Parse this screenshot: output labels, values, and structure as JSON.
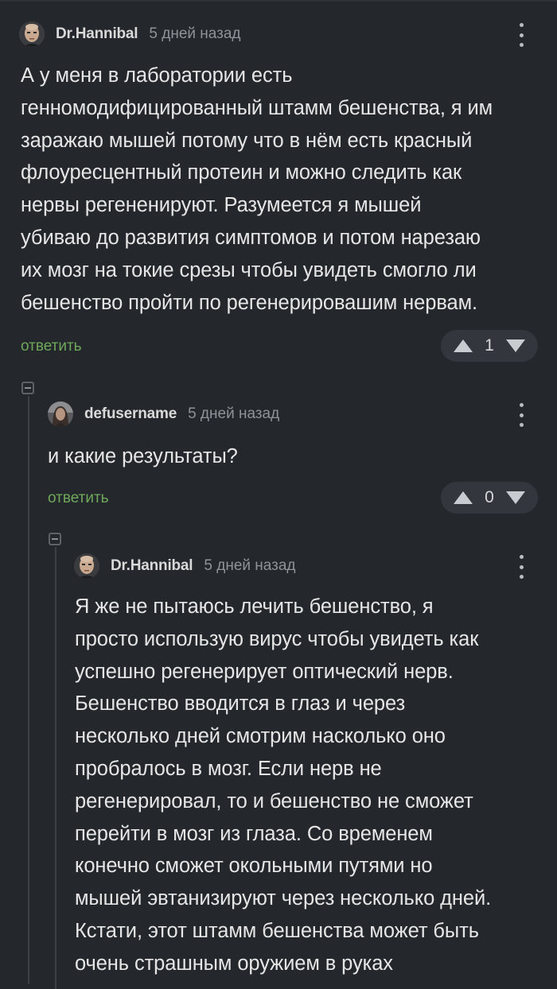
{
  "comments": [
    {
      "author": "Dr.Hannibal",
      "time": "5 дней назад",
      "avatar_icon": "bald-man-avatar-icon",
      "lines": [
        "А у меня в лаборатории есть",
        "генномодифицированный штамм бешенства, я им",
        "заражаю мышей потому что в нём есть красный",
        "флоуресцентный протеин и можно следить как",
        "нервы регененируют. Разумеется я мышей",
        "убиваю до развития симптомов и потом нарезаю",
        "их мозг на токие срезы чтобы увидеть смогло ли",
        "бешенство пройти по регенерировашим нервам."
      ],
      "reply_label": "ответить",
      "score": "1"
    },
    {
      "author": "defusername",
      "time": "5 дней назад",
      "avatar_icon": "long-hair-avatar-icon",
      "lines": [
        "и какие результаты?"
      ],
      "reply_label": "ответить",
      "score": "0"
    },
    {
      "author": "Dr.Hannibal",
      "time": "5 дней назад",
      "avatar_icon": "bald-man-avatar-icon",
      "lines": [
        "Я же не пытаюсь лечить бешенство, я",
        "просто использую вирус чтобы увидеть как",
        "успешно регенерирует оптический нерв.",
        "Бешенство вводится в глаз и через",
        "несколько дней смотрим насколько оно",
        "пробралось в мозг. Если нерв не",
        "регенерировал, то и бешенство не сможет",
        "перейти в мозг из глаза. Со временем",
        "конечно сможет окольными путями но",
        "мышей эвтанизируют через несколько дней.",
        "Кстати, этот штамм бешенства может быть",
        "очень страшным оружием в руках"
      ]
    }
  ],
  "colors": {
    "background": "#24272c",
    "reply_green": "#6fa85b",
    "vote_pill": "#33373d"
  }
}
